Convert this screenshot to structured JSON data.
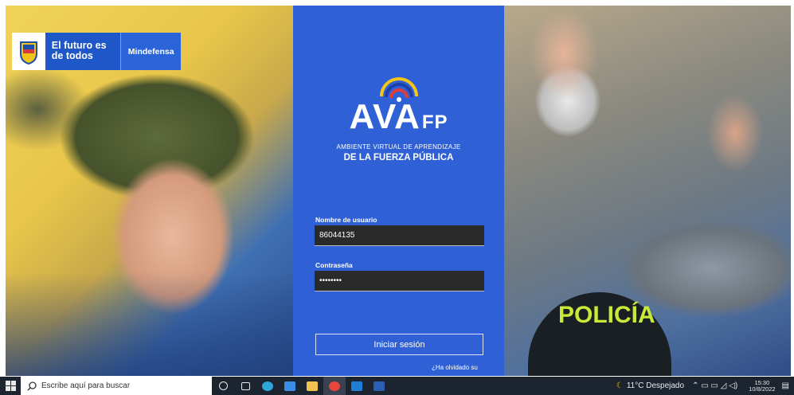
{
  "brand": {
    "slogan": "El futuro es de todos",
    "ministry": "Mindefensa"
  },
  "logo": {
    "mark": "AVA",
    "suffix": "FP",
    "subtitle_1": "AMBIENTE VIRTUAL DE APRENDIZAJE",
    "subtitle_2": "DE LA FUERZA PÚBLICA"
  },
  "login": {
    "username_label": "Nombre de usuario",
    "username_value": "86044135",
    "password_label": "Contraseña",
    "password_value": "••••••••",
    "submit_label": "Iniciar sesión",
    "forgot_label": "¿Ha olvidado su"
  },
  "scene": {
    "police_text": "POLICÍA"
  },
  "taskbar": {
    "search_placeholder": "Escribe aquí para buscar",
    "weather": "11°C  Despejado",
    "time": "15:30",
    "date": "10/8/2022"
  },
  "colors": {
    "panel": "#2f60d6",
    "brand_blue": "#1f56c8",
    "taskbar": "#1c2430"
  }
}
